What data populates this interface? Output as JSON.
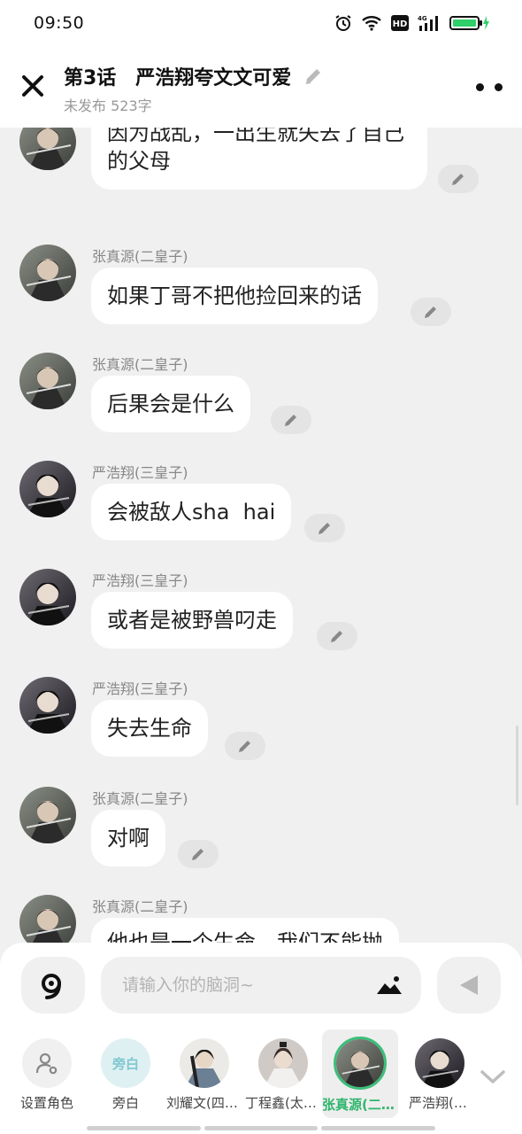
{
  "status_bar": {
    "time": "09:50",
    "network_label": "4G",
    "hd_label": "HD"
  },
  "header": {
    "title": "第3话　严浩翔夸文文可爱",
    "subtitle": "未发布 523字"
  },
  "messages": [
    {
      "sender": "",
      "text": "因为战乱，一出生就失去了自己的父母",
      "avatar": "zhang"
    },
    {
      "sender": "张真源(二皇子)",
      "text": "如果丁哥不把他捡回来的话",
      "avatar": "zhang"
    },
    {
      "sender": "张真源(二皇子)",
      "text": "后果会是什么",
      "avatar": "zhang"
    },
    {
      "sender": "严浩翔(三皇子)",
      "text": "会被敌人sha  hai",
      "avatar": "yan"
    },
    {
      "sender": "严浩翔(三皇子)",
      "text": "或者是被野兽叼走",
      "avatar": "yan"
    },
    {
      "sender": "严浩翔(三皇子)",
      "text": "失去生命",
      "avatar": "yan"
    },
    {
      "sender": "张真源(二皇子)",
      "text": "对啊",
      "avatar": "zhang"
    },
    {
      "sender": "张真源(二皇子)",
      "text": "他也是一个生命，我们不能抛",
      "avatar": "zhang"
    }
  ],
  "input": {
    "placeholder": "请输入你的脑洞~"
  },
  "roles": [
    {
      "label": "设置角色",
      "badge": "",
      "selected": false
    },
    {
      "label": "旁白",
      "badge": "旁白",
      "selected": false
    },
    {
      "label": "刘耀文(四皇子)",
      "badge": "",
      "selected": false
    },
    {
      "label": "丁程鑫(太子)",
      "badge": "",
      "selected": false
    },
    {
      "label": "张真源(二皇子)",
      "badge": "",
      "selected": true
    },
    {
      "label": "严浩翔(三皇子)",
      "badge": "",
      "selected": false
    }
  ],
  "colors": {
    "accent": "#3bbf7a",
    "background": "#f0f0f0",
    "bubble": "#ffffff"
  }
}
